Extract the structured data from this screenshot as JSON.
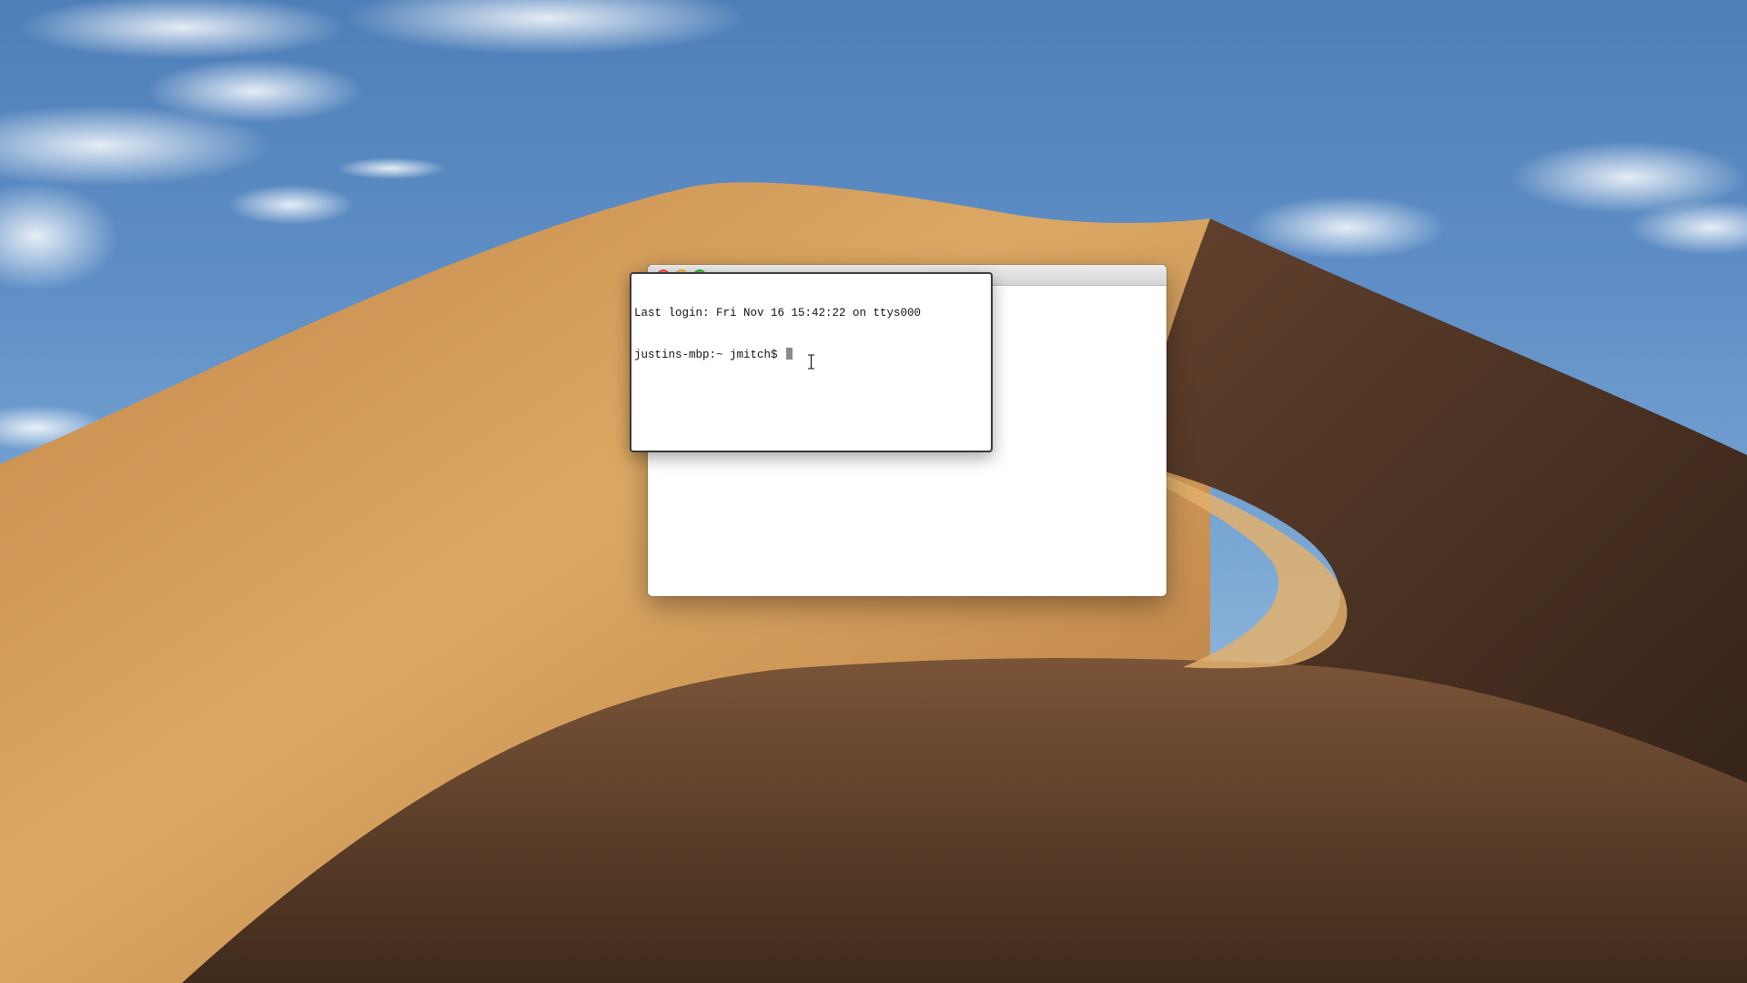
{
  "desktop": {
    "wallpaper": "Mojave desert dune",
    "colors": {
      "sky": "#5f8fc6",
      "dune_light": "#d9a35e",
      "dune_mid": "#c3874a",
      "dune_shadow": "#4a3222"
    }
  },
  "terminal_back": {
    "title": "",
    "background": "#ffffff"
  },
  "terminal_front": {
    "lines": [
      "Last login: Fri Nov 16 15:42:22 on ttys000",
      "justins-mbp:~ jmitch$ "
    ],
    "cursor": "block-cursor"
  },
  "pointer": {
    "icon": "ibeam-cursor-icon"
  }
}
